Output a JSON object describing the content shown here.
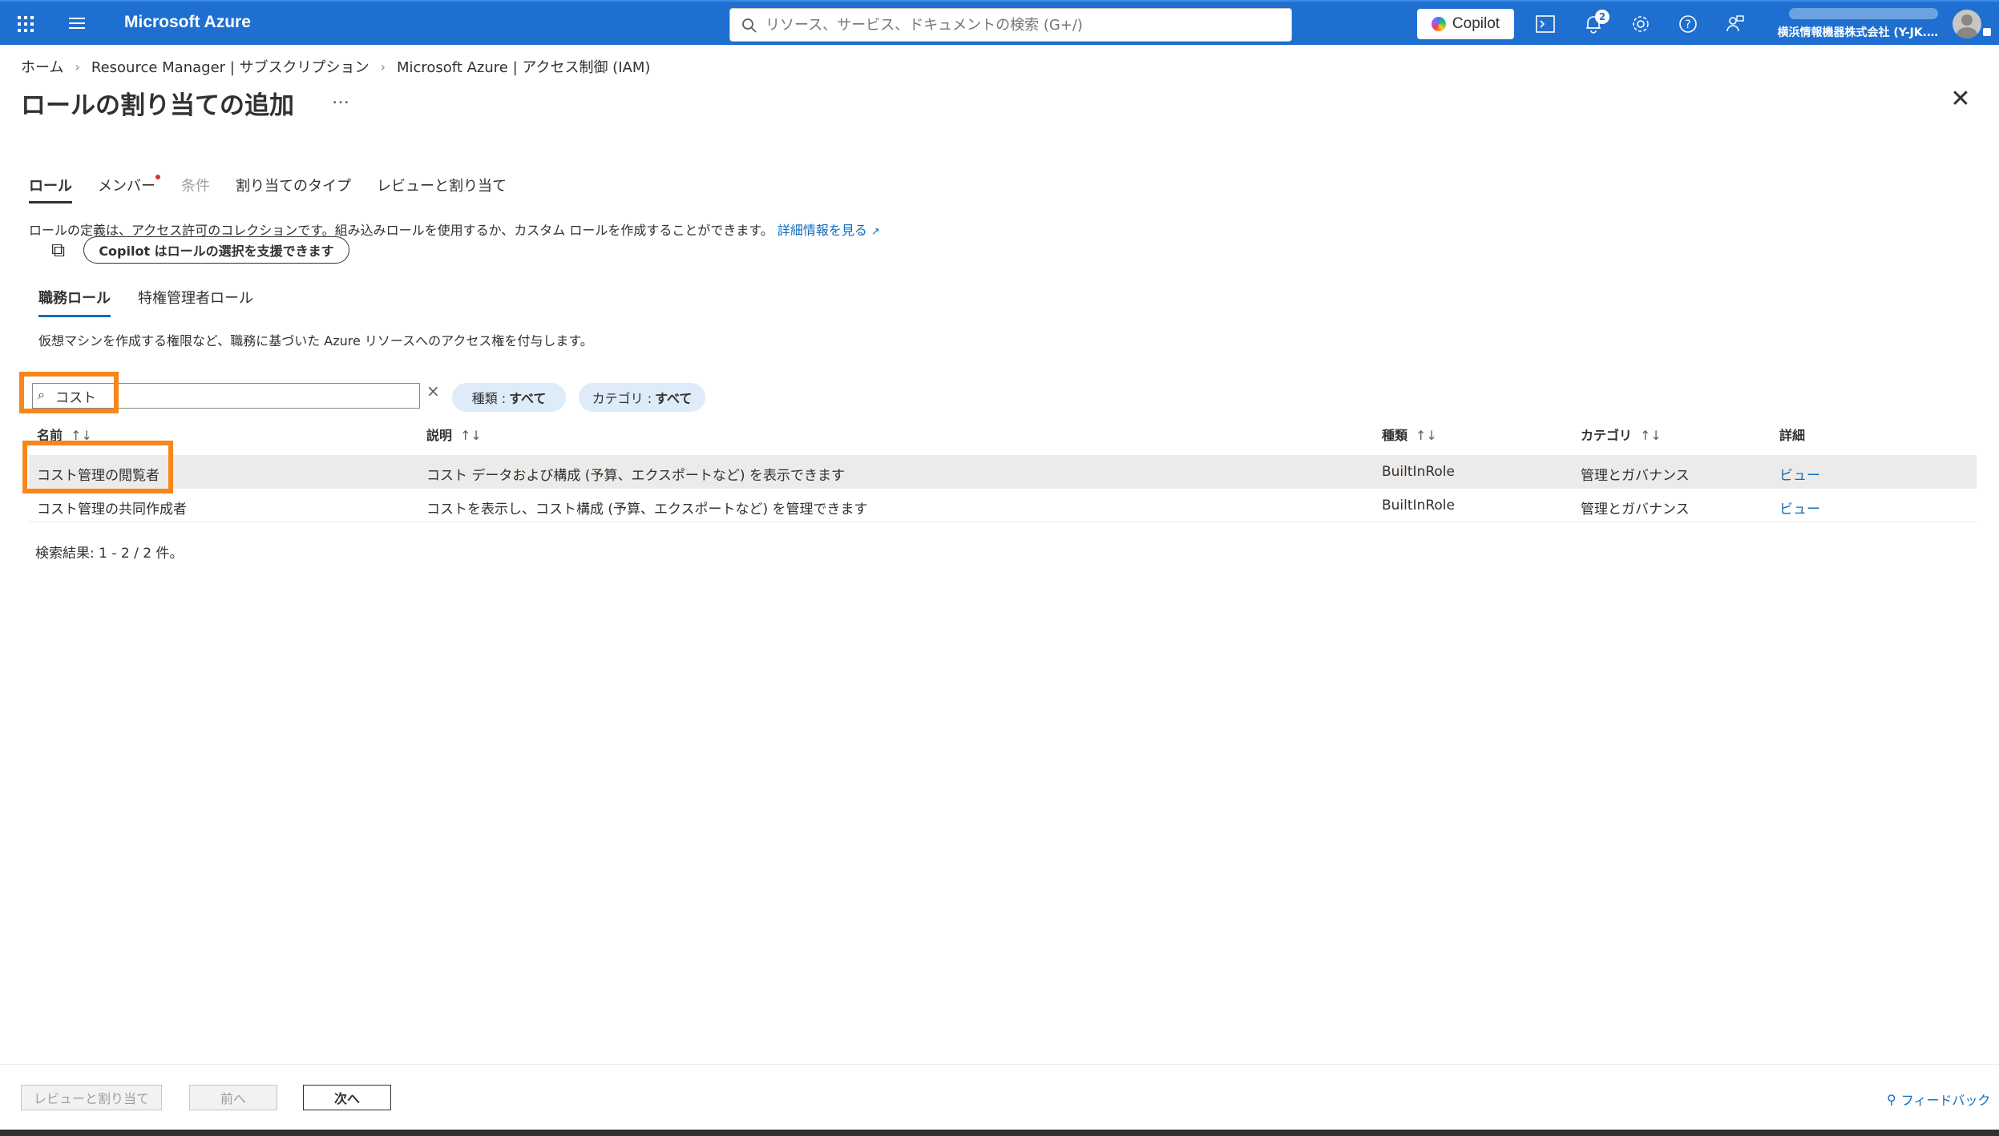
{
  "topbar": {
    "brand": "Microsoft Azure",
    "search_placeholder": "リソース、サービス、ドキュメントの検索 (G+/)",
    "copilot_label": "Copilot",
    "notification_count": "2",
    "tenant": "横浜情報機器株式会社 (Y-JK.…",
    "colors": {
      "bar": "#1f6fd0",
      "accent": "#0f6cbd",
      "highlight": "#f7861c"
    }
  },
  "breadcrumb": [
    "ホーム",
    "Resource Manager | サブスクリプション",
    "Microsoft Azure | アクセス制御 (IAM)"
  ],
  "page": {
    "title": "ロールの割り当ての追加",
    "more": "…"
  },
  "tabs": [
    {
      "label": "ロール",
      "state": "active"
    },
    {
      "label": "メンバー",
      "state": "normal"
    },
    {
      "label": "条件",
      "state": "disabled"
    },
    {
      "label": "割り当てのタイプ",
      "state": "normal"
    },
    {
      "label": "レビューと割り当て",
      "state": "normal"
    }
  ],
  "description": {
    "text": "ロールの定義は、アクセス許可のコレクションです。組み込みロールを使用するか、カスタム ロールを作成することができます。",
    "link": "詳細情報を見る"
  },
  "copilot_hint": "Copilot はロールの選択を支援できます",
  "subtabs": [
    {
      "label": "職務ロール",
      "state": "active"
    },
    {
      "label": "特権管理者ロール",
      "state": "normal"
    }
  ],
  "subdescription": "仮想マシンを作成する権限など、職務に基づいた Azure リソースへのアクセス権を付与します。",
  "filter": {
    "value": "コスト",
    "pill_type_label": "種類 :",
    "pill_type_value": "すべて",
    "pill_category_label": "カテゴリ :",
    "pill_category_value": "すべて"
  },
  "table": {
    "columns": [
      "名前",
      "説明",
      "種類",
      "カテゴリ",
      "詳細"
    ],
    "sort_glyph": "↑↓",
    "rows": [
      {
        "name": "コスト管理の閲覧者",
        "description": "コスト データおよび構成 (予算、エクスポートなど) を表示できます",
        "type": "BuiltInRole",
        "category": "管理とガバナンス",
        "detail": "ビュー"
      },
      {
        "name": "コスト管理の共同作成者",
        "description": "コストを表示し、コスト構成 (予算、エクスポートなど) を管理できます",
        "type": "BuiltInRole",
        "category": "管理とガバナンス",
        "detail": "ビュー"
      }
    ]
  },
  "result_text": "検索結果: 1 - 2 / 2 件。",
  "footer": {
    "review_label": "レビューと割り当て",
    "prev_label": "前へ",
    "next_label": "次へ",
    "feedback_label": "フィードバック"
  }
}
